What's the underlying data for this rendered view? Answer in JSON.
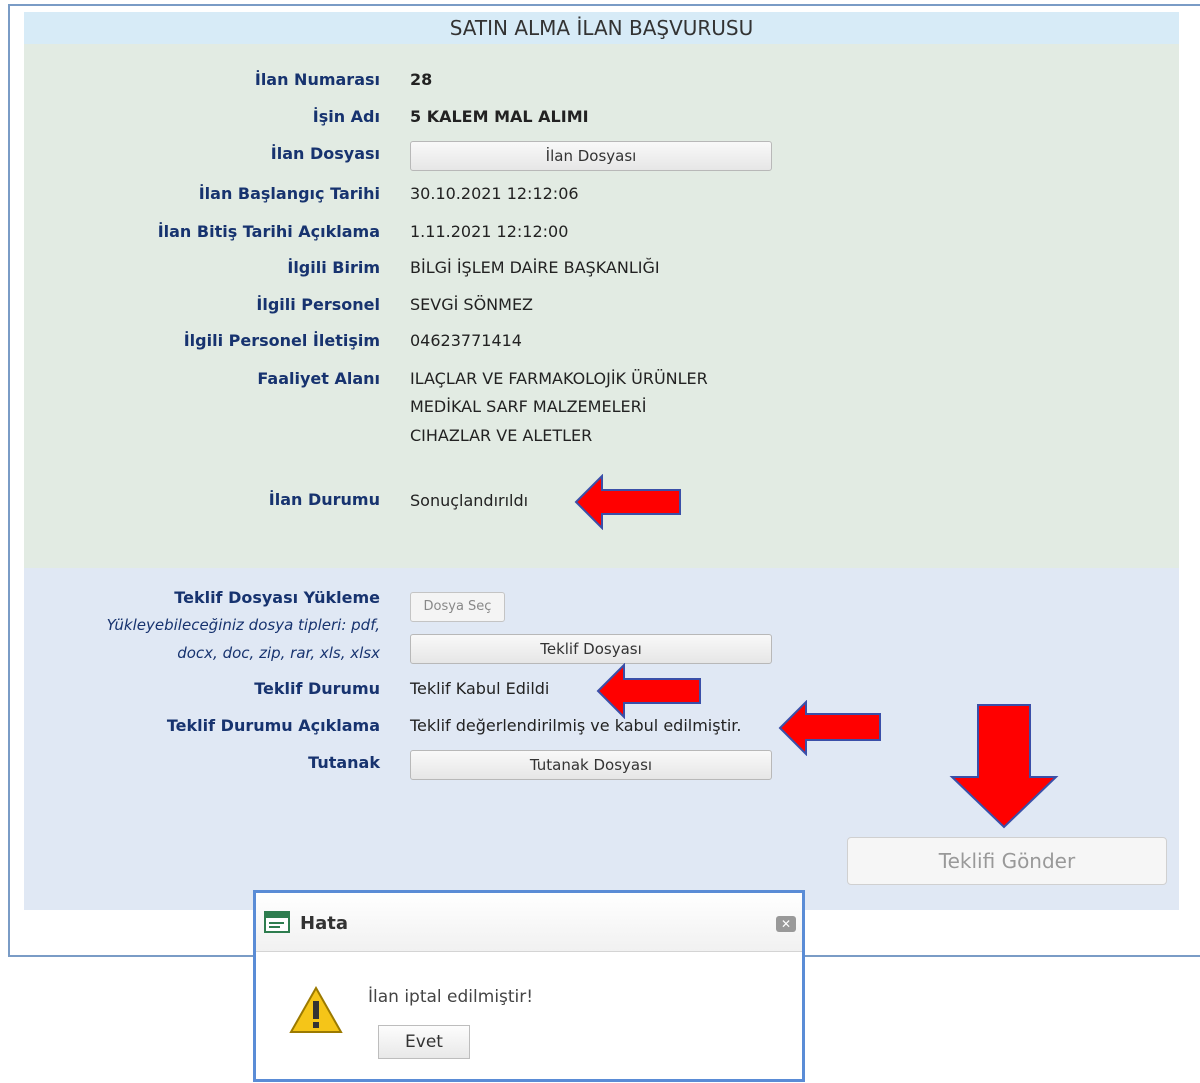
{
  "page_title": "SATIN ALMA İLAN BAŞVURUSU",
  "info": {
    "ilan_numarasi_label": "İlan Numarası",
    "ilan_numarasi": "28",
    "isin_adi_label": "İşin Adı",
    "isin_adi": "5 KALEM MAL ALIMI",
    "ilan_dosyasi_label": "İlan Dosyası",
    "ilan_dosyasi_button": "İlan Dosyası",
    "baslangic_label": "İlan Başlangıç Tarihi",
    "baslangic": "30.10.2021 12:12:06",
    "bitis_label": "İlan Bitiş Tarihi Açıklama",
    "bitis": "1.11.2021 12:12:00",
    "birim_label": "İlgili Birim",
    "birim": "BİLGİ İŞLEM DAİRE BAŞKANLIĞI",
    "personel_label": "İlgili Personel",
    "personel": "SEVGİ SÖNMEZ",
    "iletisim_label": "İlgili Personel İletişim",
    "iletisim": "04623771414",
    "faaliyet_label": "Faaliyet Alanı",
    "faaliyet": [
      "ILAÇLAR VE FARMAKOLOJİK ÜRÜNLER",
      "MEDİKAL SARF MALZEMELERİ",
      "CIHAZLAR VE ALETLER"
    ],
    "durum_label": "İlan Durumu",
    "durum": "Sonuçlandırıldı"
  },
  "offer": {
    "yukleme_label": "Teklif Dosyası Yükleme",
    "hint_lines": [
      "Yükleyebileceğiniz dosya tipleri: pdf,",
      "docx, doc, zip, rar, xls, xlsx"
    ],
    "dosya_sec": "Dosya Seç",
    "teklif_dosyasi_button": "Teklif Dosyası",
    "teklif_durumu_label": "Teklif Durumu",
    "teklif_durumu": "Teklif Kabul Edildi",
    "aciklama_label": "Teklif Durumu Açıklama",
    "aciklama": "Teklif değerlendirilmiş ve kabul edilmiştir.",
    "tutanak_label": "Tutanak",
    "tutanak_button": "Tutanak Dosyası",
    "send_button": "Teklifi Gönder"
  },
  "dialog": {
    "title": "Hata",
    "message": "İlan iptal edilmiştir!",
    "ok_button": "Evet",
    "close_icon": "close-icon",
    "warning_icon": "warning-icon"
  },
  "colors": {
    "label": "#17336f",
    "arrow": "#ff0000",
    "info_bg": "#e2ebe3",
    "offer_bg": "#e0e8f4",
    "title_bg": "#d7ebf7"
  }
}
